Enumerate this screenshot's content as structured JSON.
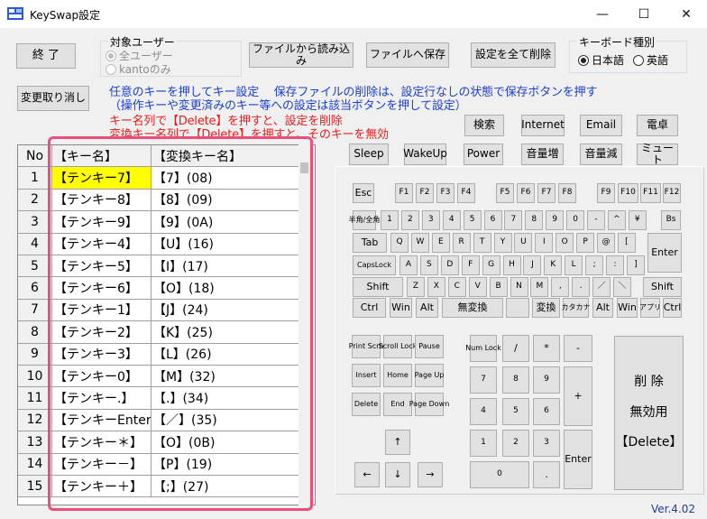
{
  "window": {
    "title": "KeySwap設定",
    "minimize_glyph": "—",
    "maximize_glyph": "☐",
    "close_glyph": "✕"
  },
  "toolbar": {
    "end_label": "終 了",
    "undo_label": "変更取り消し",
    "load_label": "ファイルから読み込み",
    "save_label": "ファイルへ保存",
    "delete_all_label": "設定を全て削除"
  },
  "target_user": {
    "title": "対象ユーザー",
    "options": [
      "全ユーザー",
      "kantoのみ"
    ],
    "selected": "全ユーザー"
  },
  "keyboard_type": {
    "title": "キーボード種別",
    "options": [
      "日本語",
      "英語"
    ],
    "selected": "日本語"
  },
  "notes": {
    "blue_line1": "任意のキーを押してキー設定　 保存ファイルの削除は、設定行なしの状態で保存ボタンを押す",
    "blue_line2": "（操作キーや変更済みのキー等への設定は該当ボタンを押して設定）",
    "red_line1": "キー名列で【Delete】を押すと、設定を削除",
    "red_line2": "変換キー名列で【Delete】を押すと、そのキーを無効"
  },
  "grid": {
    "headers": [
      "No",
      "【キー名】",
      "【変換キー名】"
    ],
    "rows": [
      {
        "no": "1",
        "key": "【テンキー7】",
        "mapped": "【7】(08)"
      },
      {
        "no": "2",
        "key": "【テンキー8】",
        "mapped": "【8】(09)"
      },
      {
        "no": "3",
        "key": "【テンキー9】",
        "mapped": "【9】(0A)"
      },
      {
        "no": "4",
        "key": "【テンキー4】",
        "mapped": "【U】(16)"
      },
      {
        "no": "5",
        "key": "【テンキー5】",
        "mapped": "【I】(17)"
      },
      {
        "no": "6",
        "key": "【テンキー6】",
        "mapped": "【O】(18)"
      },
      {
        "no": "7",
        "key": "【テンキー1】",
        "mapped": "【J】(24)"
      },
      {
        "no": "8",
        "key": "【テンキー2】",
        "mapped": "【K】(25)"
      },
      {
        "no": "9",
        "key": "【テンキー3】",
        "mapped": "【L】(26)"
      },
      {
        "no": "10",
        "key": "【テンキー0】",
        "mapped": "【M】(32)"
      },
      {
        "no": "11",
        "key": "【テンキー.】",
        "mapped": "【.】(34)"
      },
      {
        "no": "12",
        "key": "【テンキーEnter】",
        "mapped": "【／】(35)"
      },
      {
        "no": "13",
        "key": "【テンキー＊】",
        "mapped": "【O】(0B)"
      },
      {
        "no": "14",
        "key": "【テンキー－】",
        "mapped": "【P】(19)"
      },
      {
        "no": "15",
        "key": "【テンキー＋】",
        "mapped": "【;】(27)"
      }
    ],
    "selected_row": 0
  },
  "media_keys": [
    "検索",
    "Internet",
    "Email",
    "電卓",
    "Sleep",
    "WakeUp",
    "Power",
    "音量増",
    "音量減",
    "ミュート"
  ],
  "keyboard": {
    "fn_row": [
      "Esc",
      "F1",
      "F2",
      "F3",
      "F4",
      "F5",
      "F6",
      "F7",
      "F8",
      "F9",
      "F10",
      "F11",
      "F12"
    ],
    "num_row": [
      "半角/全角",
      "1",
      "2",
      "3",
      "4",
      "5",
      "6",
      "7",
      "8",
      "9",
      "0",
      "-",
      "^",
      "¥",
      "Bs"
    ],
    "q_row": [
      "Tab",
      "Q",
      "W",
      "E",
      "R",
      "T",
      "Y",
      "U",
      "I",
      "O",
      "P",
      "@",
      "[",
      "Enter"
    ],
    "a_row": [
      "CapsLock",
      "A",
      "S",
      "D",
      "F",
      "G",
      "H",
      "J",
      "K",
      "L",
      ";",
      ":",
      "]"
    ],
    "z_row": [
      "Shift",
      "Z",
      "X",
      "C",
      "V",
      "B",
      "N",
      "M",
      ",",
      ".",
      "／",
      "＼",
      "Shift"
    ],
    "bottom_row": [
      "Ctrl",
      "Win",
      "Alt",
      "無変換",
      "",
      "変換",
      "カタカナ",
      "Alt",
      "Win",
      "アプリ",
      "Ctrl"
    ],
    "nav": [
      "Print Scrn",
      "Scroll Lock",
      "Pause",
      "Insert",
      "Home",
      "Page Up",
      "Delete",
      "End",
      "Page Down"
    ],
    "arrows": [
      "↑",
      "←",
      "↓",
      "→"
    ],
    "numpad": [
      "Num Lock",
      "/",
      "*",
      "-",
      "7",
      "8",
      "9",
      "+",
      "4",
      "5",
      "6",
      "1",
      "2",
      "3",
      "Enter",
      "0",
      "."
    ],
    "special": {
      "line1": "削 除",
      "line2": "無効用",
      "line3": "【Delete】"
    }
  },
  "version": "Ver.4.02",
  "colors": {
    "note_blue": "#1a3fd0",
    "note_red": "#e81c1c",
    "highlight": "#ec4e7a",
    "selected_cell": "#ffff00",
    "version_blue": "#1c3f9c"
  }
}
